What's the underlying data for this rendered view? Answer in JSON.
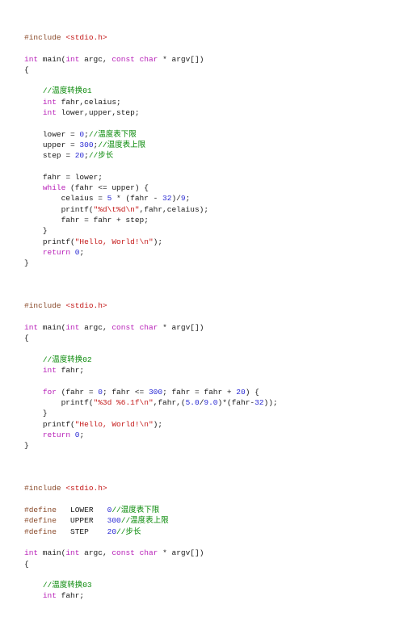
{
  "code": {
    "b1": {
      "l1a": "#include",
      "l1b": "<stdio.h>",
      "l2a": "int",
      "l2b": " main(",
      "l2c": "int",
      "l2d": " argc, ",
      "l2e": "const",
      "l2f": " ",
      "l2g": "char",
      "l2h": " * argv[])",
      "l3": "{",
      "c1": "//温度转换01",
      "d1a": "int",
      "d1b": " fahr,celaius;",
      "d2a": "int",
      "d2b": " lower,upper,step;",
      "s1a": "lower = ",
      "s1n": "0",
      "s1b": ";",
      "s1c": "//温度表下限",
      "s2a": "upper = ",
      "s2n": "300",
      "s2b": ";",
      "s2c": "//温度表上限",
      "s3a": "step = ",
      "s3n": "20",
      "s3b": ";",
      "s3c": "//步长",
      "a1": "fahr = lower;",
      "w1a": "while",
      "w1b": " (fahr <= upper) {",
      "w2a": "celaius = ",
      "w2n1": "5",
      "w2b": " * (fahr - ",
      "w2n2": "32",
      "w2c": ")/",
      "w2n3": "9",
      "w2d": ";",
      "w3a": "printf(",
      "w3s": "\"%d\\t%d\\n\"",
      "w3b": ",fahr,celaius);",
      "w4": "fahr = fahr + step;",
      "w5": "}",
      "p1a": "printf(",
      "p1s": "\"Hello, World!\\n\"",
      "p1b": ");",
      "r1a": "return",
      "r1b": " ",
      "r1n": "0",
      "r1c": ";",
      "e1": "}"
    },
    "b2": {
      "l1a": "#include",
      "l1b": "<stdio.h>",
      "l2a": "int",
      "l2b": " main(",
      "l2c": "int",
      "l2d": " argc, ",
      "l2e": "const",
      "l2f": " ",
      "l2g": "char",
      "l2h": " * argv[])",
      "l3": "{",
      "c1": "//温度转换02",
      "d1a": "int",
      "d1b": " fahr;",
      "f1a": "for",
      "f1b": " (fahr = ",
      "f1n1": "0",
      "f1c": "; fahr <= ",
      "f1n2": "300",
      "f1d": "; fahr = fahr + ",
      "f1n3": "20",
      "f1e": ") {",
      "f2a": "printf(",
      "f2s": "\"%3d %6.1f\\n\"",
      "f2b": ",fahr,(",
      "f2n1": "5.0",
      "f2c": "/",
      "f2n2": "9.0",
      "f2d": ")*(fahr-",
      "f2n3": "32",
      "f2e": "));",
      "f3": "}",
      "p1a": "printf(",
      "p1s": "\"Hello, World!\\n\"",
      "p1b": ");",
      "r1a": "return",
      "r1b": " ",
      "r1n": "0",
      "r1c": ";",
      "e1": "}"
    },
    "b3": {
      "l1a": "#include",
      "l1b": "<stdio.h>",
      "df1a": "#define",
      "df1b": "   LOWER   ",
      "df1n": "0",
      "df1c": "//温度表下限",
      "df2a": "#define",
      "df2b": "   UPPER   ",
      "df2n": "300",
      "df2c": "//温度表上限",
      "df3a": "#define",
      "df3b": "   STEP    ",
      "df3n": "20",
      "df3c": "//步长",
      "l2a": "int",
      "l2b": " main(",
      "l2c": "int",
      "l2d": " argc, ",
      "l2e": "const",
      "l2f": " ",
      "l2g": "char",
      "l2h": " * argv[])",
      "l3": "{",
      "c1": "//温度转换03",
      "d1a": "int",
      "d1b": " fahr;"
    }
  }
}
